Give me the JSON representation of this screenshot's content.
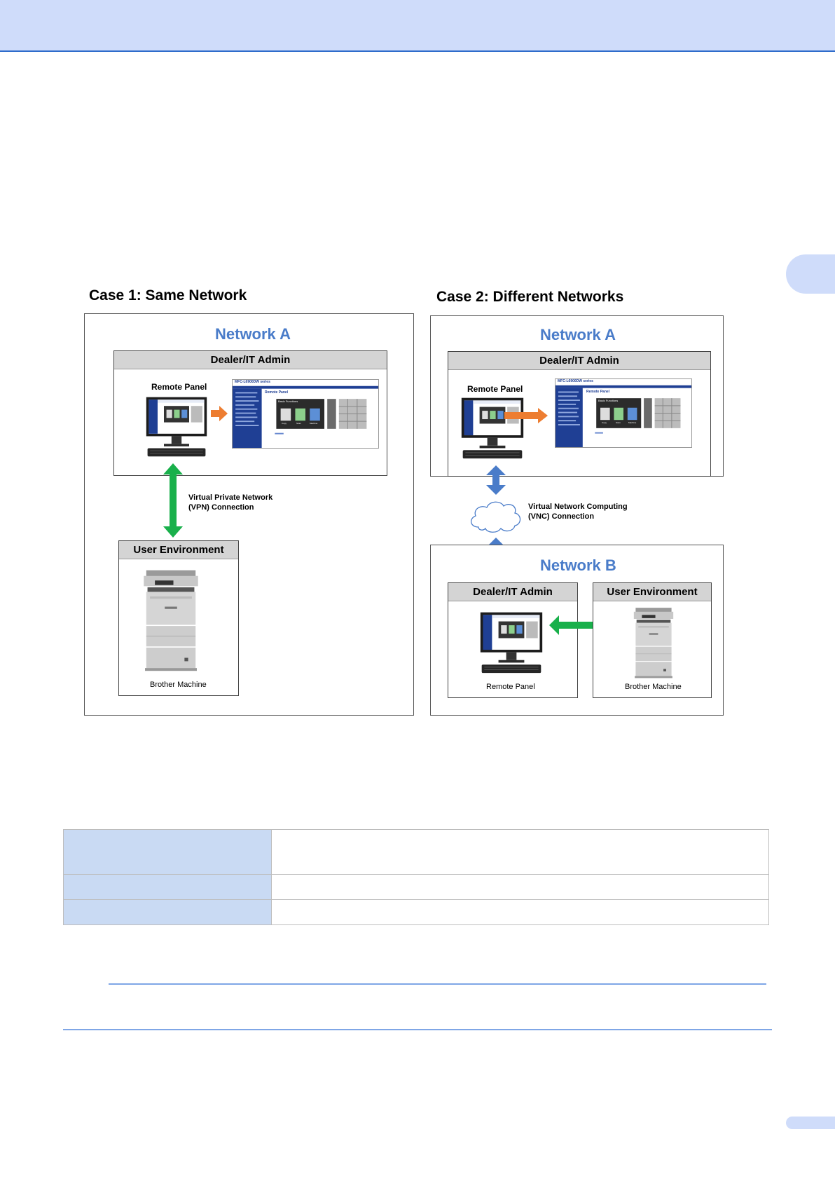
{
  "case1": {
    "title": "Case 1: Same Network",
    "network_label": "Network A",
    "admin_box": "Dealer/IT Admin",
    "remote_panel_label": "Remote Panel",
    "connection_line1": "Virtual Private Network",
    "connection_line2": "(VPN) Connection",
    "user_box": "User Environment",
    "machine_label": "Brother Machine",
    "screenshot": {
      "model": "MFC-L6900DW series",
      "section": "Remote Panel",
      "screen_title": "Basic Functions",
      "tiles": [
        "Copy",
        "Scan",
        "Machine"
      ]
    }
  },
  "case2": {
    "title": "Case 2: Different Networks",
    "network_a_label": "Network A",
    "admin_box": "Dealer/IT Admin",
    "remote_panel_label": "Remote Panel",
    "connection_line1": "Virtual Network Computing",
    "connection_line2": "(VNC) Connection",
    "network_b_label": "Network B",
    "admin_box_b": "Dealer/IT Admin",
    "user_box": "User Environment",
    "remote_panel_bottom": "Remote Panel",
    "machine_label": "Brother Machine",
    "screenshot": {
      "model": "MFC-L6900DW series",
      "section": "Remote Panel",
      "screen_title": "Basic Functions",
      "tiles": [
        "Copy",
        "Scan",
        "Machine"
      ]
    }
  },
  "colors": {
    "network_title": "#4a7cc9",
    "green_arrow": "#19b04b",
    "blue_arrow": "#4a7cc9",
    "orange_arrow": "#ed7d31",
    "header_band": "#cfdcfa",
    "table_key_cell": "#c9daf3"
  }
}
